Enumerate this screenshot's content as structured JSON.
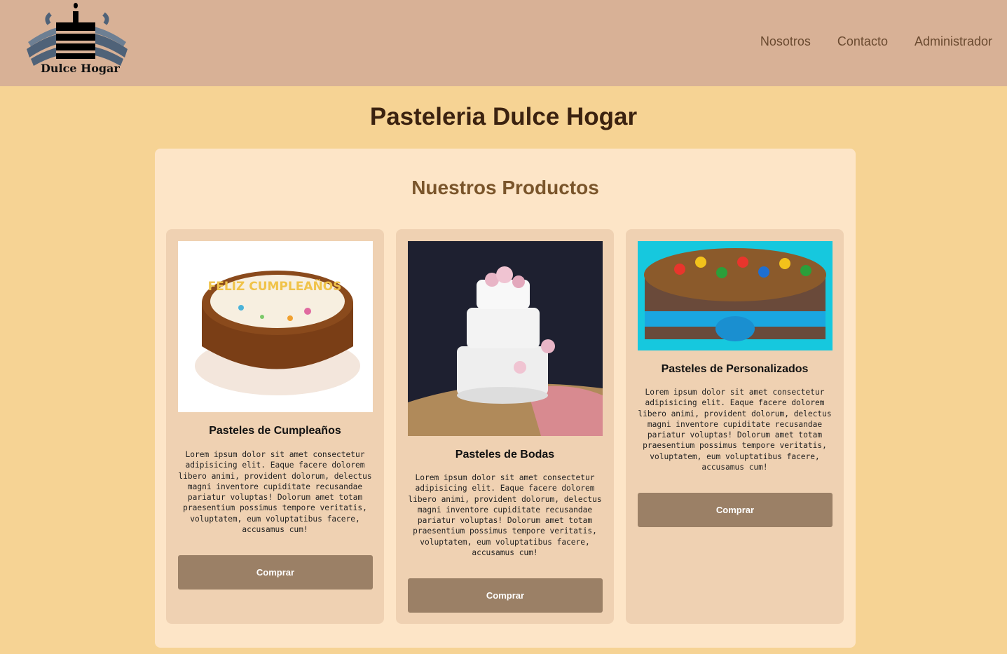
{
  "brand": {
    "name": "Dulce Hogar"
  },
  "nav": {
    "items": [
      "Nosotros",
      "Contacto",
      "Administrador"
    ]
  },
  "page_title": "Pasteleria Dulce Hogar",
  "products": {
    "title": "Nuestros Productos",
    "items": [
      {
        "name": "Pasteles de Cumpleaños",
        "description": "Lorem ipsum dolor sit amet consectetur adipisicing elit. Eaque facere dolorem libero animi, provident dolorum, delectus magni inventore cupiditate recusandae pariatur voluptas! Dolorum amet totam praesentium possimus tempore veritatis, voluptatem, eum voluptatibus facere, accusamus cum!",
        "button": "Comprar",
        "image_text": "FELIZ CUMPLEAÑOS"
      },
      {
        "name": "Pasteles de Bodas",
        "description": "Lorem ipsum dolor sit amet consectetur adipisicing elit. Eaque facere dolorem libero animi, provident dolorum, delectus magni inventore cupiditate recusandae pariatur voluptas! Dolorum amet totam praesentium possimus tempore veritatis, voluptatem, eum voluptatibus facere, accusamus cum!",
        "button": "Comprar"
      },
      {
        "name": "Pasteles de Personalizados",
        "description": "Lorem ipsum dolor sit amet consectetur adipisicing elit. Eaque facere dolorem libero animi, provident dolorum, delectus magni inventore cupiditate recusandae pariatur voluptas! Dolorum amet totam praesentium possimus tempore veritatis, voluptatem, eum voluptatibus facere, accusamus cum!",
        "button": "Comprar"
      }
    ]
  },
  "colors": {
    "header_bg": "#d8b196",
    "page_bg": "#f6d394",
    "panel_bg": "#fde5c7",
    "card_bg": "#efd1b2",
    "button_bg": "#9b8066",
    "title_color": "#3b2210",
    "subtitle_color": "#7a552b"
  }
}
